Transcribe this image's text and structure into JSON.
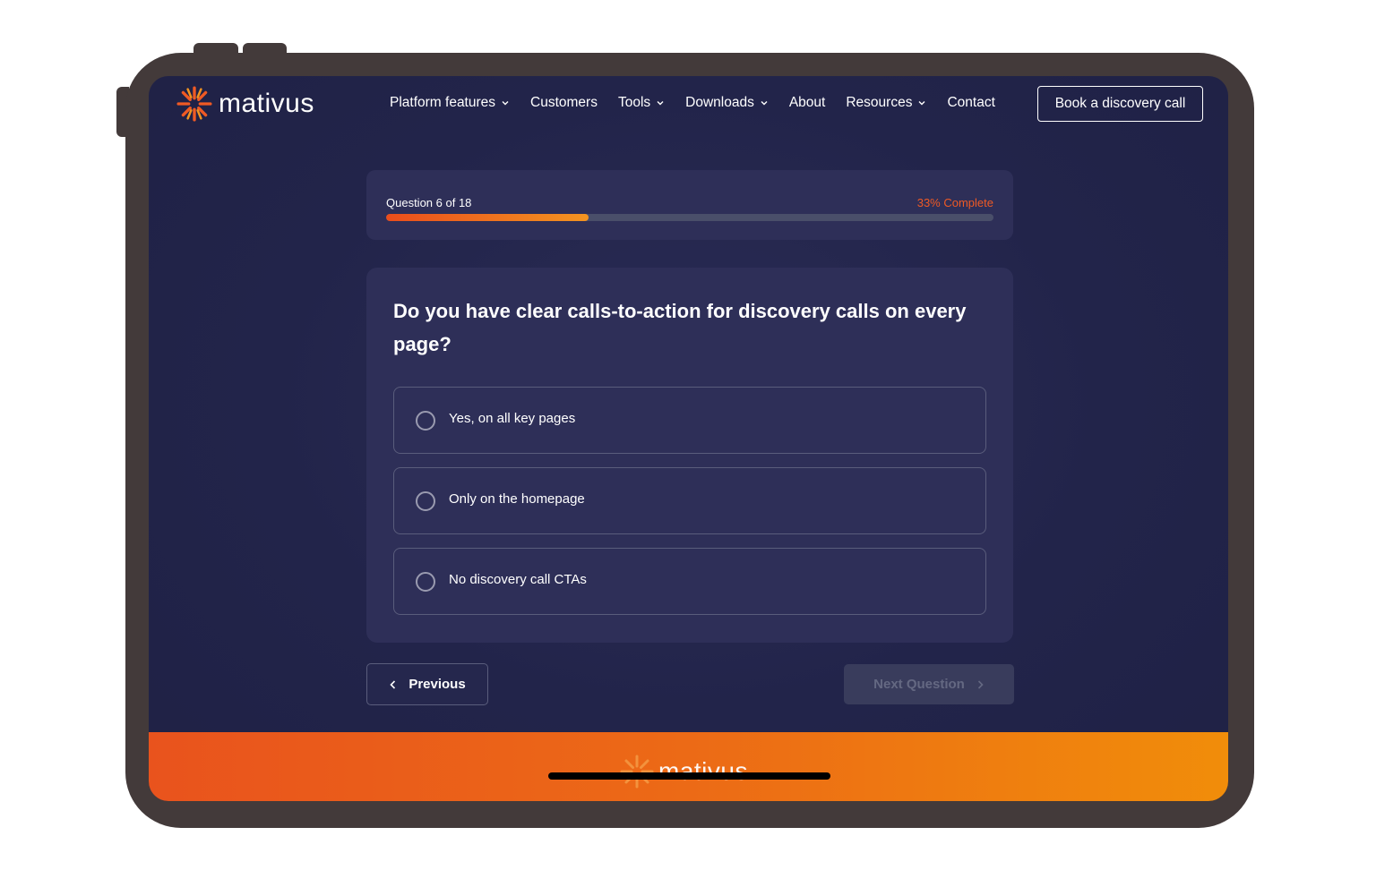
{
  "brand": {
    "name": "mativus",
    "accent": "#f05a24"
  },
  "nav": {
    "items": [
      {
        "label": "Platform features",
        "has_dropdown": true
      },
      {
        "label": "Customers",
        "has_dropdown": false
      },
      {
        "label": "Tools",
        "has_dropdown": true
      },
      {
        "label": "Downloads",
        "has_dropdown": true
      },
      {
        "label": "About",
        "has_dropdown": false
      },
      {
        "label": "Resources",
        "has_dropdown": true
      },
      {
        "label": "Contact",
        "has_dropdown": false
      }
    ],
    "cta_label": "Book a discovery call"
  },
  "progress": {
    "question_label": "Question 6 of 18",
    "percent_label": "33% Complete",
    "fraction": 0.333
  },
  "question": {
    "title": "Do you have clear calls-to-action for discovery calls on every page?",
    "options": [
      {
        "label": "Yes, on all key pages"
      },
      {
        "label": "Only on the homepage"
      },
      {
        "label": "No discovery call CTAs"
      }
    ]
  },
  "buttons": {
    "previous_label": "Previous",
    "next_label": "Next Question"
  },
  "footer": {
    "brand": "mativus"
  }
}
